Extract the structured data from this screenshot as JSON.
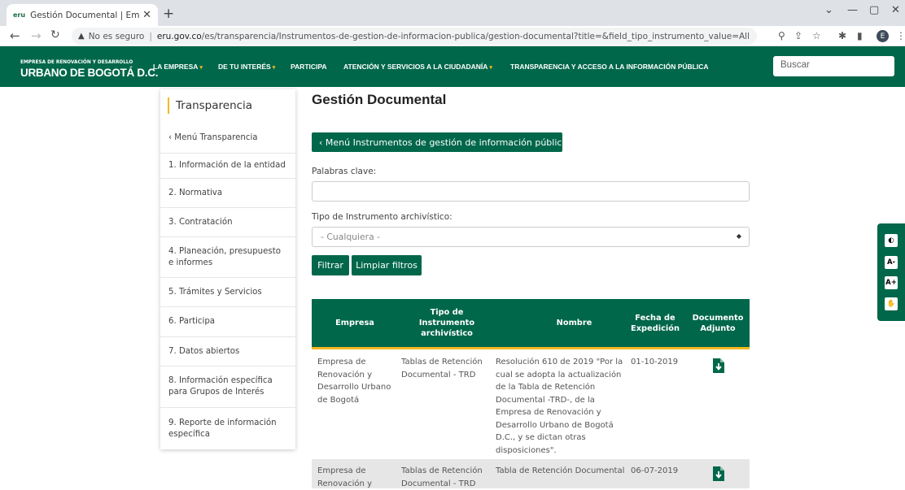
{
  "browser": {
    "tab_title": "Gestión Documental | Empresa d",
    "favicon_text": "eru",
    "new_tab": "+",
    "security_label": "No es seguro",
    "url_host": "eru.gov.co",
    "url_path": "/es/transparencia/Instrumentos-de-gestion-de-informacion-publica/gestion-documental?title=&field_tipo_instrumento_value=All",
    "profile_initial": "E"
  },
  "site": {
    "logo_line1": "EMPRESA DE RENOVACIÓN Y DESARROLLO",
    "logo_line2": "URBANO DE BOGOTÁ D.C.",
    "nav": [
      {
        "label": "LA EMPRESA",
        "has_caret": true
      },
      {
        "label": "DE TU INTERÉS",
        "has_caret": true
      },
      {
        "label": "PARTICIPA",
        "has_caret": false
      },
      {
        "label": "ATENCIÓN Y SERVICIOS A LA CIUDADANÍA",
        "has_caret": true
      },
      {
        "label": "TRANSPARENCIA Y ACCESO A LA INFORMACIÓN PÚBLICA",
        "has_caret": false
      }
    ],
    "search_placeholder": "Buscar"
  },
  "sidebar": {
    "title": "Transparencia",
    "items": [
      "‹ Menú Transparencia",
      "1. Información de la entidad",
      "2. Normativa",
      "3. Contratación",
      "4. Planeación, presupuesto e informes",
      "5. Trámites y Servicios",
      "6. Participa",
      "7. Datos abiertos",
      "8. Información específica para Grupos de Interés",
      "9. Reporte de información específica"
    ]
  },
  "main": {
    "title": "Gestión Documental",
    "menu_button": "‹ Menú Instrumentos de gestión de información pública",
    "keywords_label": "Palabras clave:",
    "type_label": "Tipo de Instrumento archivístico:",
    "type_selected": "- Cualquiera -",
    "filter_button": "Filtrar",
    "clear_button": "Limpiar filtros"
  },
  "table": {
    "headers": [
      "Empresa",
      "Tipo de Instrumento archivístico",
      "Nombre",
      "Fecha de Expedición",
      "Documento Adjunto"
    ],
    "rows": [
      {
        "empresa": "Empresa de Renovación y Desarrollo Urbano de Bogotá",
        "tipo": "Tablas de Retención Documental - TRD",
        "nombre": "Resolución 610 de 2019 \"Por la cual se adopta la actualización de la Tabla de Retención Documental -TRD-, de la Empresa de Renovación y Desarrollo Urbano de Bogotá D.C., y se dictan otras disposiciones\".",
        "fecha": "01-10-2019"
      },
      {
        "empresa": "Empresa de Renovación y",
        "tipo": "Tablas de Retención Documental - TRD",
        "nombre": "Tabla de Retención Documental",
        "fecha": "06-07-2019"
      }
    ]
  },
  "accessibility": {
    "contrast": "◐",
    "font_smaller": "A-",
    "font_larger": "A+",
    "sign_language": "✋"
  },
  "colors": {
    "primary": "#00674a",
    "accent": "#f4b921",
    "row_alt": "#e6e6e6"
  }
}
